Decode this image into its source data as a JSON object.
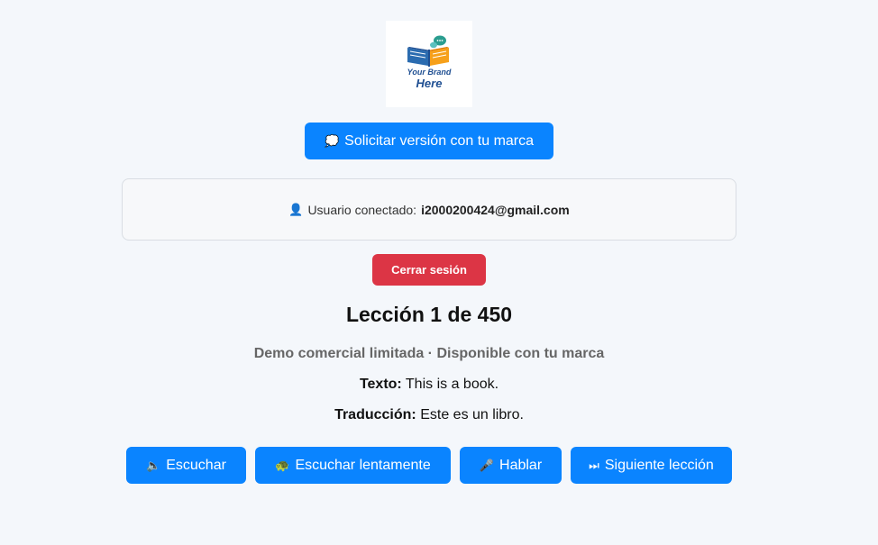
{
  "logo": {
    "line1": "Your Brand",
    "line2": "Here"
  },
  "request_button": {
    "icon": "speech-bubble-icon",
    "label": "Solicitar versión con tu marca"
  },
  "user_box": {
    "icon": "user-icon",
    "label": "Usuario conectado:",
    "email": "i2000200424@gmail.com"
  },
  "logout_button": {
    "label": "Cerrar sesión",
    "color": "#dc3545"
  },
  "lesson": {
    "title": "Lección 1 de 450",
    "subtitle": "Demo comercial limitada · Disponible con tu marca",
    "text_label": "Texto:",
    "text_value": "This is a book.",
    "translation_label": "Traducción:",
    "translation_value": "Este es un libro."
  },
  "actions": [
    {
      "icon": "speaker-icon",
      "label": "Escuchar"
    },
    {
      "icon": "turtle-icon",
      "label": "Escuchar lentamente"
    },
    {
      "icon": "microphone-icon",
      "label": "Hablar"
    },
    {
      "icon": "next-track-icon",
      "label": "Siguiente lección"
    }
  ],
  "colors": {
    "primary": "#0a84ff",
    "background": "#f4f7fb"
  }
}
